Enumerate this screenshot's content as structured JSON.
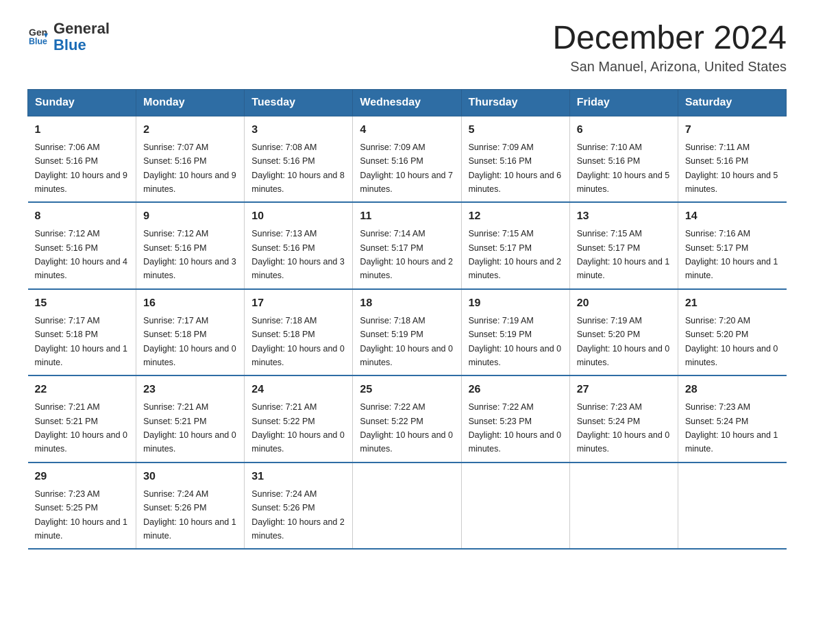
{
  "header": {
    "logo_line1": "General",
    "logo_line2": "Blue",
    "title": "December 2024",
    "subtitle": "San Manuel, Arizona, United States"
  },
  "days_of_week": [
    "Sunday",
    "Monday",
    "Tuesday",
    "Wednesday",
    "Thursday",
    "Friday",
    "Saturday"
  ],
  "weeks": [
    [
      {
        "day": "1",
        "sunrise": "7:06 AM",
        "sunset": "5:16 PM",
        "daylight": "10 hours and 9 minutes."
      },
      {
        "day": "2",
        "sunrise": "7:07 AM",
        "sunset": "5:16 PM",
        "daylight": "10 hours and 9 minutes."
      },
      {
        "day": "3",
        "sunrise": "7:08 AM",
        "sunset": "5:16 PM",
        "daylight": "10 hours and 8 minutes."
      },
      {
        "day": "4",
        "sunrise": "7:09 AM",
        "sunset": "5:16 PM",
        "daylight": "10 hours and 7 minutes."
      },
      {
        "day": "5",
        "sunrise": "7:09 AM",
        "sunset": "5:16 PM",
        "daylight": "10 hours and 6 minutes."
      },
      {
        "day": "6",
        "sunrise": "7:10 AM",
        "sunset": "5:16 PM",
        "daylight": "10 hours and 5 minutes."
      },
      {
        "day": "7",
        "sunrise": "7:11 AM",
        "sunset": "5:16 PM",
        "daylight": "10 hours and 5 minutes."
      }
    ],
    [
      {
        "day": "8",
        "sunrise": "7:12 AM",
        "sunset": "5:16 PM",
        "daylight": "10 hours and 4 minutes."
      },
      {
        "day": "9",
        "sunrise": "7:12 AM",
        "sunset": "5:16 PM",
        "daylight": "10 hours and 3 minutes."
      },
      {
        "day": "10",
        "sunrise": "7:13 AM",
        "sunset": "5:16 PM",
        "daylight": "10 hours and 3 minutes."
      },
      {
        "day": "11",
        "sunrise": "7:14 AM",
        "sunset": "5:17 PM",
        "daylight": "10 hours and 2 minutes."
      },
      {
        "day": "12",
        "sunrise": "7:15 AM",
        "sunset": "5:17 PM",
        "daylight": "10 hours and 2 minutes."
      },
      {
        "day": "13",
        "sunrise": "7:15 AM",
        "sunset": "5:17 PM",
        "daylight": "10 hours and 1 minute."
      },
      {
        "day": "14",
        "sunrise": "7:16 AM",
        "sunset": "5:17 PM",
        "daylight": "10 hours and 1 minute."
      }
    ],
    [
      {
        "day": "15",
        "sunrise": "7:17 AM",
        "sunset": "5:18 PM",
        "daylight": "10 hours and 1 minute."
      },
      {
        "day": "16",
        "sunrise": "7:17 AM",
        "sunset": "5:18 PM",
        "daylight": "10 hours and 0 minutes."
      },
      {
        "day": "17",
        "sunrise": "7:18 AM",
        "sunset": "5:18 PM",
        "daylight": "10 hours and 0 minutes."
      },
      {
        "day": "18",
        "sunrise": "7:18 AM",
        "sunset": "5:19 PM",
        "daylight": "10 hours and 0 minutes."
      },
      {
        "day": "19",
        "sunrise": "7:19 AM",
        "sunset": "5:19 PM",
        "daylight": "10 hours and 0 minutes."
      },
      {
        "day": "20",
        "sunrise": "7:19 AM",
        "sunset": "5:20 PM",
        "daylight": "10 hours and 0 minutes."
      },
      {
        "day": "21",
        "sunrise": "7:20 AM",
        "sunset": "5:20 PM",
        "daylight": "10 hours and 0 minutes."
      }
    ],
    [
      {
        "day": "22",
        "sunrise": "7:21 AM",
        "sunset": "5:21 PM",
        "daylight": "10 hours and 0 minutes."
      },
      {
        "day": "23",
        "sunrise": "7:21 AM",
        "sunset": "5:21 PM",
        "daylight": "10 hours and 0 minutes."
      },
      {
        "day": "24",
        "sunrise": "7:21 AM",
        "sunset": "5:22 PM",
        "daylight": "10 hours and 0 minutes."
      },
      {
        "day": "25",
        "sunrise": "7:22 AM",
        "sunset": "5:22 PM",
        "daylight": "10 hours and 0 minutes."
      },
      {
        "day": "26",
        "sunrise": "7:22 AM",
        "sunset": "5:23 PM",
        "daylight": "10 hours and 0 minutes."
      },
      {
        "day": "27",
        "sunrise": "7:23 AM",
        "sunset": "5:24 PM",
        "daylight": "10 hours and 0 minutes."
      },
      {
        "day": "28",
        "sunrise": "7:23 AM",
        "sunset": "5:24 PM",
        "daylight": "10 hours and 1 minute."
      }
    ],
    [
      {
        "day": "29",
        "sunrise": "7:23 AM",
        "sunset": "5:25 PM",
        "daylight": "10 hours and 1 minute."
      },
      {
        "day": "30",
        "sunrise": "7:24 AM",
        "sunset": "5:26 PM",
        "daylight": "10 hours and 1 minute."
      },
      {
        "day": "31",
        "sunrise": "7:24 AM",
        "sunset": "5:26 PM",
        "daylight": "10 hours and 2 minutes."
      },
      {
        "day": "",
        "sunrise": "",
        "sunset": "",
        "daylight": ""
      },
      {
        "day": "",
        "sunrise": "",
        "sunset": "",
        "daylight": ""
      },
      {
        "day": "",
        "sunrise": "",
        "sunset": "",
        "daylight": ""
      },
      {
        "day": "",
        "sunrise": "",
        "sunset": "",
        "daylight": ""
      }
    ]
  ]
}
